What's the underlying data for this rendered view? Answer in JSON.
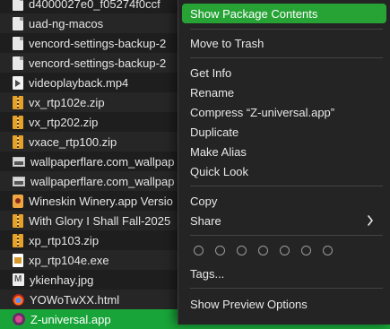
{
  "files": [
    {
      "name": "d4000027e0_f05274f0ccf",
      "icon": "document-icon",
      "kind": "doc"
    },
    {
      "name": "uad-ng-macos",
      "icon": "document-icon",
      "kind": "doc"
    },
    {
      "name": "vencord-settings-backup-2",
      "icon": "document-icon",
      "kind": "doc"
    },
    {
      "name": "vencord-settings-backup-2",
      "icon": "document-icon",
      "kind": "doc"
    },
    {
      "name": "videoplayback.mp4",
      "icon": "video-file-icon",
      "kind": "video"
    },
    {
      "name": "vx_rtp102e.zip",
      "icon": "zip-archive-icon",
      "kind": "zip"
    },
    {
      "name": "vx_rtp202.zip",
      "icon": "zip-archive-icon",
      "kind": "zip"
    },
    {
      "name": "vxace_rtp100.zip",
      "icon": "zip-archive-icon",
      "kind": "zip"
    },
    {
      "name": "wallpaperflare.com_wallpap",
      "icon": "image-file-icon",
      "kind": "image"
    },
    {
      "name": "wallpaperflare.com_wallpap",
      "icon": "image-file-icon",
      "kind": "image"
    },
    {
      "name": "Wineskin Winery.app Versio",
      "icon": "wineskin-app-icon",
      "kind": "winery"
    },
    {
      "name": "With Glory I Shall Fall-2025",
      "icon": "zip-archive-icon",
      "kind": "zip"
    },
    {
      "name": "xp_rtp103.zip",
      "icon": "zip-archive-icon",
      "kind": "zip"
    },
    {
      "name": "xp_rtp104e.exe",
      "icon": "exe-file-icon",
      "kind": "exe"
    },
    {
      "name": "ykienhay.jpg",
      "icon": "photo-file-icon",
      "kind": "photo"
    },
    {
      "name": "YOWoTwXX.html",
      "icon": "html-file-icon",
      "kind": "html"
    },
    {
      "name": "Z-universal.app",
      "icon": "app-icon",
      "kind": "app",
      "selected": true
    }
  ],
  "context_menu": {
    "show_package_contents": "Show Package Contents",
    "move_to_trash": "Move to Trash",
    "get_info": "Get Info",
    "rename": "Rename",
    "compress": "Compress “Z-universal.app”",
    "duplicate": "Duplicate",
    "make_alias": "Make Alias",
    "quick_look": "Quick Look",
    "copy": "Copy",
    "share": "Share",
    "tags": "Tags...",
    "show_preview_options": "Show Preview Options"
  },
  "colors": {
    "accent": "#27a336",
    "selection": "#18a438",
    "menu_bg": "#242424",
    "window_bg": "#1e1e1e"
  }
}
